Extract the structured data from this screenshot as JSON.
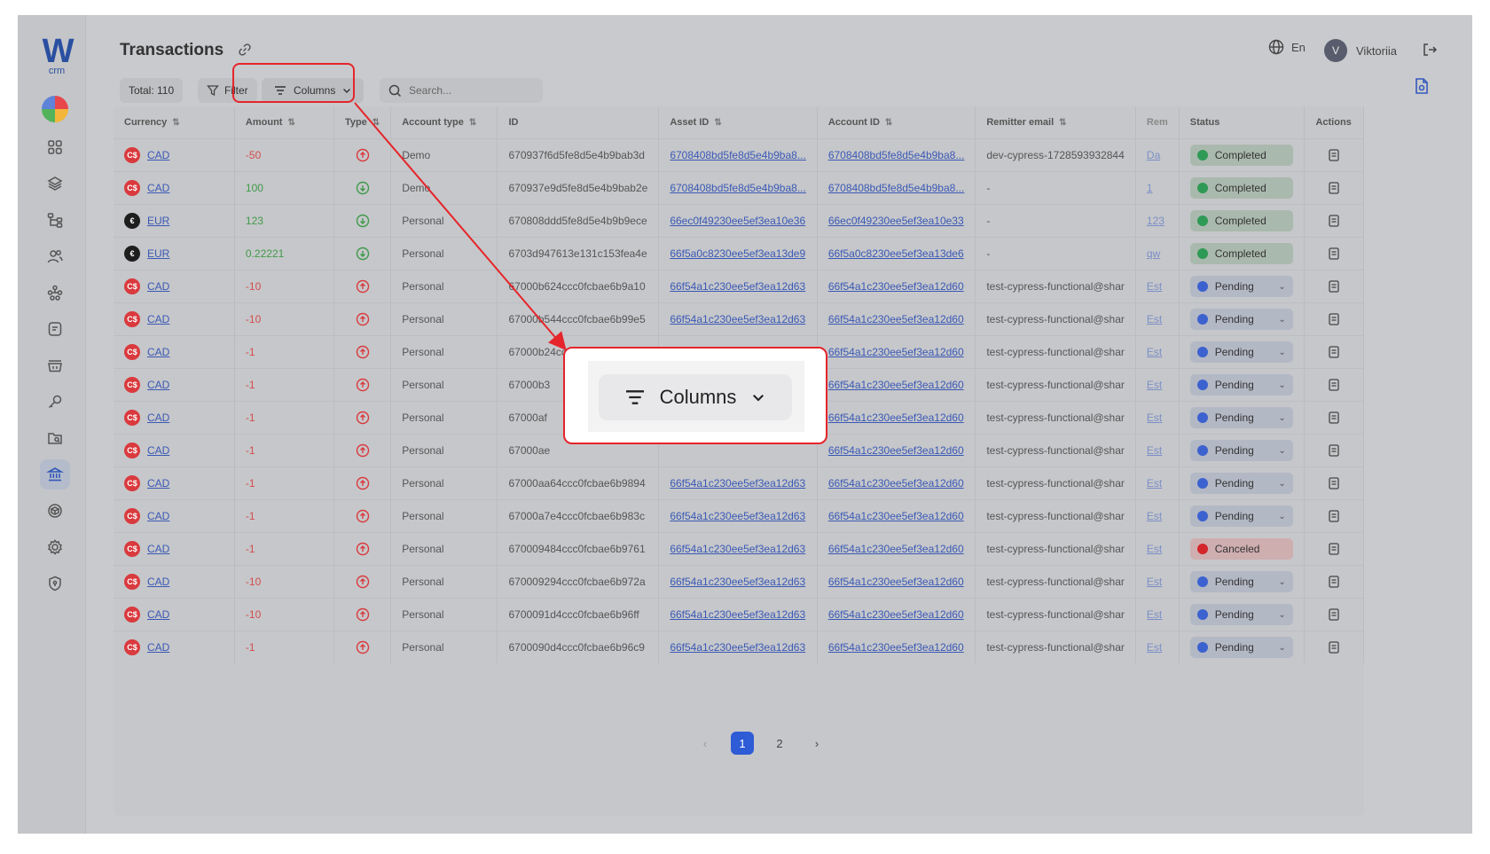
{
  "app": {
    "logo": "W",
    "logo_sub": "crm",
    "title": "Transactions",
    "lang": "En",
    "user": "Viktoriia",
    "avatar": "V"
  },
  "toolbar": {
    "total": "Total: 110",
    "filter": "Filter",
    "columns": "Columns",
    "search_placeholder": "Search..."
  },
  "table": {
    "columns": [
      "Currency",
      "Amount",
      "Type",
      "Account type",
      "ID",
      "Asset ID",
      "Account ID",
      "Remitter email",
      "Rem",
      "Status",
      "Actions"
    ],
    "rows": [
      {
        "currency": "CAD",
        "amount": "-50",
        "dir": "out",
        "account_type": "Demo",
        "id": "670937f6d5fe8d5e4b9bab3d",
        "asset_id": "6708408bd5fe8d5e4b9ba8...",
        "account_id": "6708408bd5fe8d5e4b9ba8...",
        "email": "dev-cypress-1728593932844",
        "rem": "Da",
        "status": "Completed"
      },
      {
        "currency": "CAD",
        "amount": "100",
        "dir": "in",
        "account_type": "Demo",
        "id": "670937e9d5fe8d5e4b9bab2e",
        "asset_id": "6708408bd5fe8d5e4b9ba8...",
        "account_id": "6708408bd5fe8d5e4b9ba8...",
        "email": "-",
        "rem": "1",
        "status": "Completed"
      },
      {
        "currency": "EUR",
        "amount": "123",
        "dir": "in",
        "account_type": "Personal",
        "id": "670808ddd5fe8d5e4b9b9ece",
        "asset_id": "66ec0f49230ee5ef3ea10e36",
        "account_id": "66ec0f49230ee5ef3ea10e33",
        "email": "-",
        "rem": "123",
        "status": "Completed"
      },
      {
        "currency": "EUR",
        "amount": "0.22221",
        "dir": "in",
        "account_type": "Personal",
        "id": "6703d947613e131c153fea4e",
        "asset_id": "66f5a0c8230ee5ef3ea13de9",
        "account_id": "66f5a0c8230ee5ef3ea13de6",
        "email": "-",
        "rem": "qw",
        "status": "Completed"
      },
      {
        "currency": "CAD",
        "amount": "-10",
        "dir": "out",
        "account_type": "Personal",
        "id": "67000b624ccc0fcbae6b9a10",
        "asset_id": "66f54a1c230ee5ef3ea12d63",
        "account_id": "66f54a1c230ee5ef3ea12d60",
        "email": "test-cypress-functional@shar",
        "rem": "Est",
        "status": "Pending"
      },
      {
        "currency": "CAD",
        "amount": "-10",
        "dir": "out",
        "account_type": "Personal",
        "id": "67000b544ccc0fcbae6b99e5",
        "asset_id": "66f54a1c230ee5ef3ea12d63",
        "account_id": "66f54a1c230ee5ef3ea12d60",
        "email": "test-cypress-functional@shar",
        "rem": "Est",
        "status": "Pending"
      },
      {
        "currency": "CAD",
        "amount": "-1",
        "dir": "out",
        "account_type": "Personal",
        "id": "67000b24ccc0fcbae6b99af",
        "asset_id": "66f54a1c230ee5ef3ea12d63",
        "account_id": "66f54a1c230ee5ef3ea12d60",
        "email": "test-cypress-functional@shar",
        "rem": "Est",
        "status": "Pending"
      },
      {
        "currency": "CAD",
        "amount": "-1",
        "dir": "out",
        "account_type": "Personal",
        "id": "67000b3",
        "asset_id": "",
        "account_id": "66f54a1c230ee5ef3ea12d60",
        "email": "test-cypress-functional@shar",
        "rem": "Est",
        "status": "Pending"
      },
      {
        "currency": "CAD",
        "amount": "-1",
        "dir": "out",
        "account_type": "Personal",
        "id": "67000af",
        "asset_id": "",
        "account_id": "66f54a1c230ee5ef3ea12d60",
        "email": "test-cypress-functional@shar",
        "rem": "Est",
        "status": "Pending"
      },
      {
        "currency": "CAD",
        "amount": "-1",
        "dir": "out",
        "account_type": "Personal",
        "id": "67000ae",
        "asset_id": "",
        "account_id": "66f54a1c230ee5ef3ea12d60",
        "email": "test-cypress-functional@shar",
        "rem": "Est",
        "status": "Pending"
      },
      {
        "currency": "CAD",
        "amount": "-1",
        "dir": "out",
        "account_type": "Personal",
        "id": "67000aa64ccc0fcbae6b9894",
        "asset_id": "66f54a1c230ee5ef3ea12d63",
        "account_id": "66f54a1c230ee5ef3ea12d60",
        "email": "test-cypress-functional@shar",
        "rem": "Est",
        "status": "Pending"
      },
      {
        "currency": "CAD",
        "amount": "-1",
        "dir": "out",
        "account_type": "Personal",
        "id": "67000a7e4ccc0fcbae6b983c",
        "asset_id": "66f54a1c230ee5ef3ea12d63",
        "account_id": "66f54a1c230ee5ef3ea12d60",
        "email": "test-cypress-functional@shar",
        "rem": "Est",
        "status": "Pending"
      },
      {
        "currency": "CAD",
        "amount": "-1",
        "dir": "out",
        "account_type": "Personal",
        "id": "670009484ccc0fcbae6b9761",
        "asset_id": "66f54a1c230ee5ef3ea12d63",
        "account_id": "66f54a1c230ee5ef3ea12d60",
        "email": "test-cypress-functional@shar",
        "rem": "Est",
        "status": "Canceled"
      },
      {
        "currency": "CAD",
        "amount": "-10",
        "dir": "out",
        "account_type": "Personal",
        "id": "670009294ccc0fcbae6b972a",
        "asset_id": "66f54a1c230ee5ef3ea12d63",
        "account_id": "66f54a1c230ee5ef3ea12d60",
        "email": "test-cypress-functional@shar",
        "rem": "Est",
        "status": "Pending"
      },
      {
        "currency": "CAD",
        "amount": "-10",
        "dir": "out",
        "account_type": "Personal",
        "id": "6700091d4ccc0fcbae6b96ff",
        "asset_id": "66f54a1c230ee5ef3ea12d63",
        "account_id": "66f54a1c230ee5ef3ea12d60",
        "email": "test-cypress-functional@shar",
        "rem": "Est",
        "status": "Pending"
      },
      {
        "currency": "CAD",
        "amount": "-1",
        "dir": "out",
        "account_type": "Personal",
        "id": "6700090d4ccc0fcbae6b96c9",
        "asset_id": "66f54a1c230ee5ef3ea12d63",
        "account_id": "66f54a1c230ee5ef3ea12d60",
        "email": "test-cypress-functional@shar",
        "rem": "Est",
        "status": "Pending"
      }
    ]
  },
  "pagination": {
    "pages": [
      "1",
      "2"
    ],
    "current": "1"
  },
  "zoom_callout": {
    "label": "Columns"
  },
  "colors": {
    "accent": "#2e5bd6",
    "highlight": "#e5252b",
    "completed": "#2f9a55",
    "pending": "#3c62cf",
    "canceled": "#d3262b"
  },
  "icons": {
    "sidebar": [
      "dashboard-pie-icon",
      "grid-icon",
      "layers-icon",
      "workflow-icon",
      "users-icon",
      "network-icon",
      "notes-icon",
      "basket-icon",
      "key-icon",
      "folder-search-icon",
      "bank-icon",
      "cube-icon",
      "settings-icon",
      "shield-icon"
    ]
  }
}
